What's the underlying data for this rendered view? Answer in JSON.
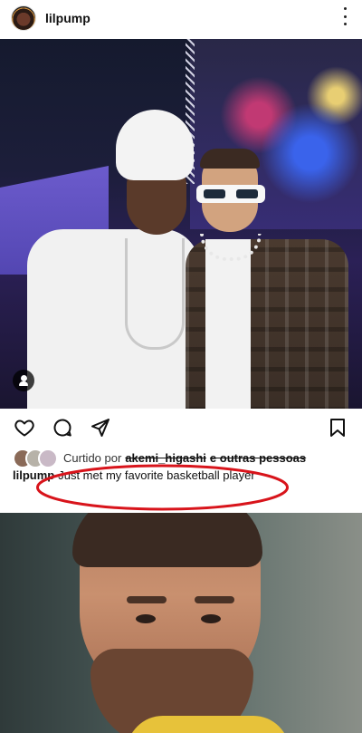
{
  "header": {
    "username": "lilpump",
    "more_icon": "more-vertical-icon"
  },
  "post": {
    "image_alt_icon": "user-tag-icon"
  },
  "actions": {
    "like_icon": "heart-icon",
    "comment_icon": "comment-bubble-icon",
    "share_icon": "send-icon",
    "save_icon": "bookmark-icon"
  },
  "likes": {
    "prefix": "Curtido por",
    "user": "akemi_higashi",
    "suffix": "e outras pessoas"
  },
  "caption": {
    "username": "lilpump",
    "text": "Just met my favorite basketball player"
  },
  "colors": {
    "annotation": "#d8141b"
  }
}
